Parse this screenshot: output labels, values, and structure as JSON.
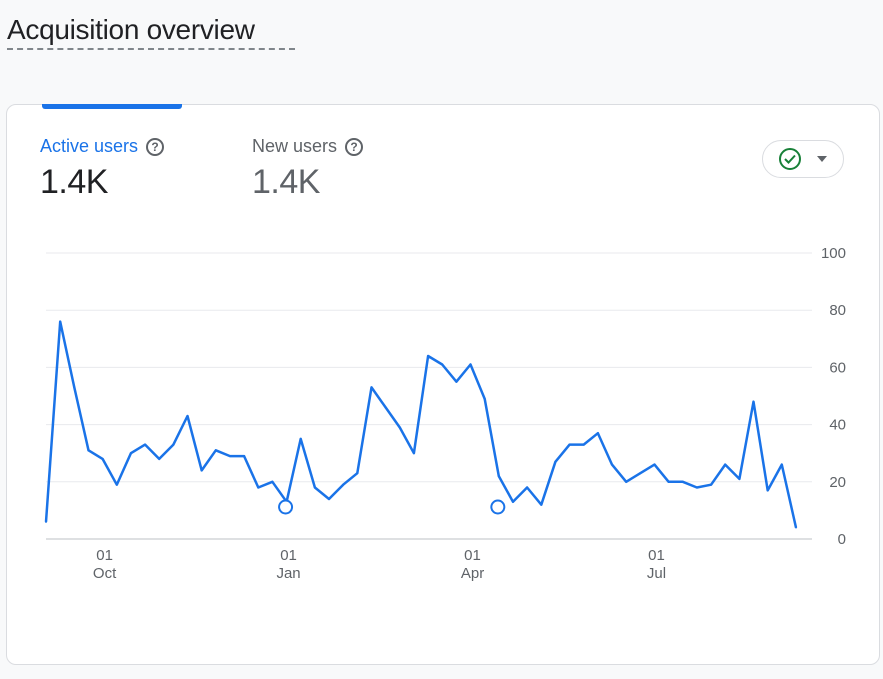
{
  "page": {
    "title": "Acquisition overview"
  },
  "metrics": [
    {
      "label": "Active users",
      "value": "1.4K",
      "help_icon": "help-circle-icon",
      "selected": true
    },
    {
      "label": "New users",
      "value": "1.4K",
      "help_icon": "help-circle-icon",
      "selected": false
    }
  ],
  "compare_button": {
    "icon": "check-circle-icon",
    "caret": "chevron-down-icon"
  },
  "colors": {
    "accent": "#1a73e8",
    "check": "#188038",
    "grid": "#e8eaed"
  },
  "chart_data": {
    "type": "line",
    "series": [
      {
        "values": [
          6,
          76,
          53,
          31,
          28,
          19,
          30,
          33,
          28,
          33,
          43,
          24,
          31,
          29,
          29,
          18,
          20,
          13,
          35,
          18,
          14,
          19,
          23,
          53,
          46,
          39,
          30,
          64,
          61,
          55,
          61,
          49,
          22,
          13,
          18,
          12,
          27,
          33,
          33,
          37,
          26,
          20,
          23,
          26,
          20,
          20,
          18,
          19,
          26,
          21,
          48,
          17,
          26,
          4
        ]
      }
    ],
    "y_ticks": [
      "0",
      "20",
      "40",
      "60",
      "80",
      "100"
    ],
    "x_ticks": [
      {
        "day": "01",
        "month": "Oct",
        "index": 4
      },
      {
        "day": "01",
        "month": "Jan",
        "index": 17
      },
      {
        "day": "01",
        "month": "Apr",
        "index": 30
      },
      {
        "day": "01",
        "month": "Jul",
        "index": 43
      }
    ],
    "markers": [
      17,
      32
    ],
    "ylim": [
      0,
      100
    ],
    "grid": true
  }
}
